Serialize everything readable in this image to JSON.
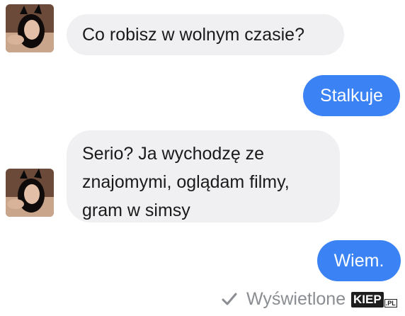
{
  "conversation": {
    "messages": [
      {
        "sender": "contact",
        "text": "Co robisz w wolnym czasie?"
      },
      {
        "sender": "me",
        "text": "Stalkuje"
      },
      {
        "sender": "contact",
        "text": "Serio? Ja wychodzę ze znajomymi, oglądam filmy, gram w simsy"
      },
      {
        "sender": "me",
        "text": "Wiem."
      }
    ],
    "status": {
      "icon": "checkmark-icon",
      "text": "Wyświetlone"
    }
  },
  "watermark": {
    "brand": "KIEP",
    "suffix": ".PL"
  },
  "colors": {
    "outgoing_bubble": "#3b83f5",
    "incoming_bubble": "#f0f0f2",
    "status_text": "#8a8d91"
  }
}
